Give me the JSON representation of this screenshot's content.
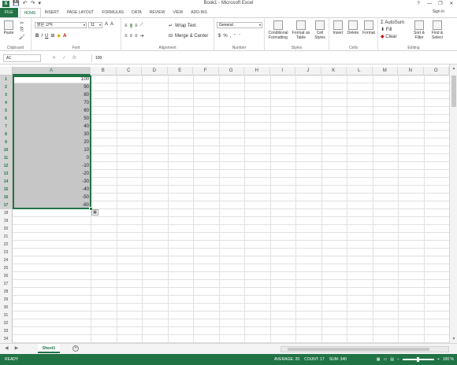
{
  "titlebar": {
    "title": "Book1 - Microsoft Excel",
    "logo": "X",
    "help": "?",
    "minimize": "—",
    "restore": "❐",
    "close": "✕"
  },
  "qat": {
    "save": "💾",
    "undo": "↶",
    "redo": "↷",
    "customize": "▾"
  },
  "tabs": [
    "FILE",
    "HOME",
    "INSERT",
    "PAGE LAYOUT",
    "FORMULAS",
    "DATA",
    "REVIEW",
    "VIEW",
    "ADD-INS"
  ],
  "signin": "Sign in",
  "ribbon": {
    "clipboard": {
      "label": "Clipboard",
      "paste": "Paste"
    },
    "font": {
      "label": "Font",
      "name": "맑은 고딕",
      "size": "11"
    },
    "alignment": {
      "label": "Alignment",
      "wrap": "Wrap Text",
      "merge": "Merge & Center"
    },
    "number": {
      "label": "Number",
      "format": "General"
    },
    "styles": {
      "label": "Styles",
      "conditional": "Conditional Formatting",
      "format_table": "Format as Table",
      "cell_styles": "Cell Styles"
    },
    "cells": {
      "label": "Cells",
      "insert": "Insert",
      "delete": "Delete",
      "format": "Format"
    },
    "editing": {
      "label": "Editing",
      "autosum": "AutoSum",
      "fill": "Fill",
      "clear": "Clear",
      "sort": "Sort & Filter",
      "find": "Find & Select"
    }
  },
  "formula": {
    "namebox": "A1",
    "value": "100",
    "fx": "fx"
  },
  "columns": [
    "A",
    "B",
    "C",
    "D",
    "E",
    "F",
    "G",
    "H",
    "I",
    "J",
    "K",
    "L",
    "M",
    "N",
    "O"
  ],
  "rows": [
    1,
    2,
    3,
    4,
    5,
    6,
    7,
    8,
    9,
    10,
    11,
    12,
    13,
    14,
    15,
    16,
    17,
    18,
    19,
    20,
    21,
    22,
    23,
    24,
    25,
    26,
    27,
    28,
    29,
    30,
    31,
    32,
    33,
    34,
    35
  ],
  "colA_values": [
    "100",
    "90",
    "80",
    "70",
    "60",
    "50",
    "40",
    "30",
    "20",
    "10",
    "0",
    "-10",
    "-20",
    "-30",
    "-40",
    "-50",
    "-60"
  ],
  "sheet": {
    "tab": "Sheet1",
    "add": "+"
  },
  "status": {
    "ready": "READY",
    "average": "AVERAGE: 20",
    "count": "COUNT: 17",
    "sum": "SUM: 340",
    "zoom": "100 %"
  }
}
